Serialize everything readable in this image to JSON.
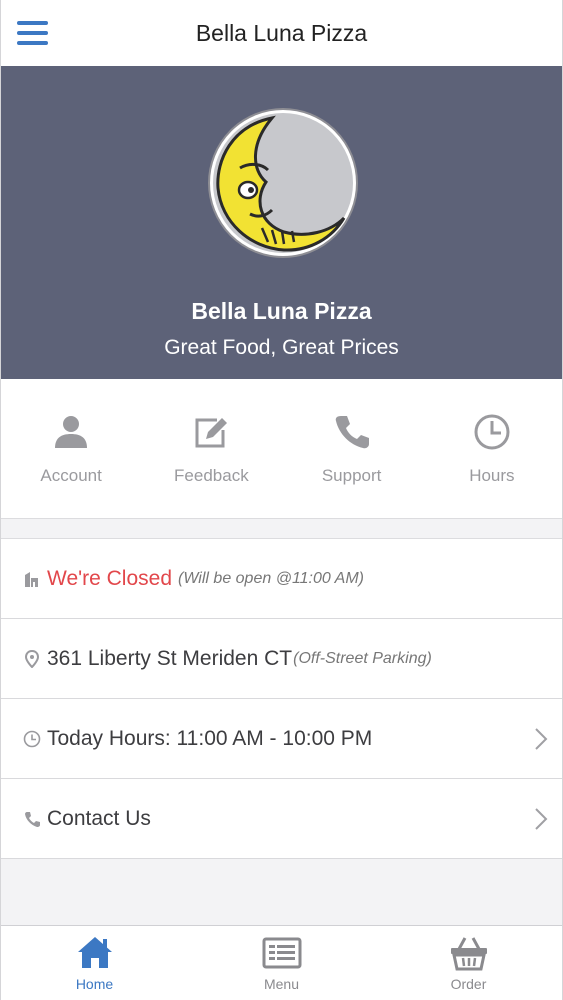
{
  "header": {
    "title": "Bella Luna Pizza",
    "menu_icon": "hamburger-menu-icon"
  },
  "hero": {
    "name": "Bella Luna Pizza",
    "tagline": "Great Food, Great Prices",
    "logo_icon": "crescent-moon-logo"
  },
  "quick_actions": [
    {
      "label": "Account",
      "icon": "person-icon"
    },
    {
      "label": "Feedback",
      "icon": "edit-icon"
    },
    {
      "label": "Support",
      "icon": "phone-icon"
    },
    {
      "label": "Hours",
      "icon": "clock-icon"
    }
  ],
  "info": {
    "status": {
      "main": "We're Closed",
      "note": "(Will be open @11:00 AM)",
      "icon": "store-icon"
    },
    "address": {
      "main": "361 Liberty St Meriden CT",
      "note": "(Off-Street Parking)",
      "icon": "map-pin-icon"
    },
    "hours": {
      "main": "Today Hours: 11:00 AM - 10:00 PM",
      "icon": "clock-icon"
    },
    "contact": {
      "main": "Contact Us",
      "icon": "phone-icon"
    }
  },
  "bottom_nav": [
    {
      "label": "Home",
      "icon": "home-icon",
      "active": true
    },
    {
      "label": "Menu",
      "icon": "menu-list-icon",
      "active": false
    },
    {
      "label": "Order",
      "icon": "basket-icon",
      "active": false
    }
  ],
  "colors": {
    "hero_bg": "#5d6278",
    "accent": "#3c78c3",
    "closed": "#e2474b",
    "icon_gray": "#9a9a9e"
  }
}
